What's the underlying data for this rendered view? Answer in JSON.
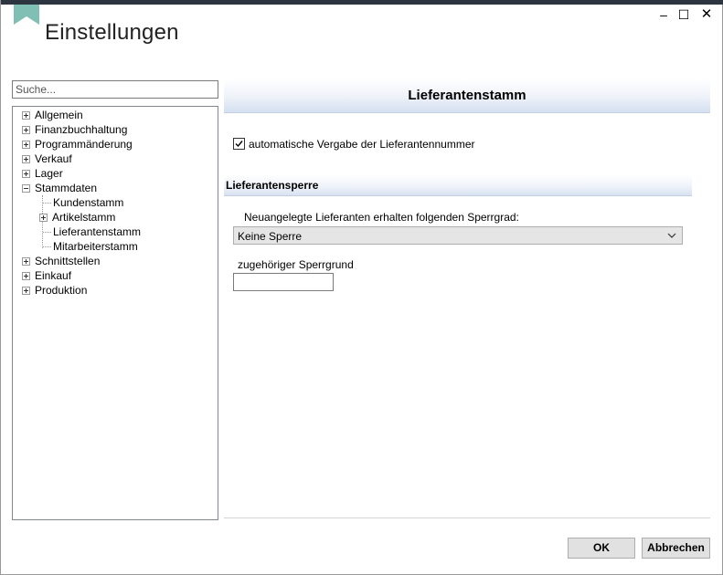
{
  "window": {
    "title": "Einstellungen",
    "controls": {
      "minimize": "–",
      "maximize": "☐",
      "close": "✕"
    },
    "accent_color": "#7fbfb4"
  },
  "search": {
    "placeholder": "Suche...",
    "value": ""
  },
  "tree": {
    "items": [
      {
        "label": "Allgemein",
        "expander": "plus",
        "level": 0
      },
      {
        "label": "Finanzbuchhaltung",
        "expander": "plus",
        "level": 0
      },
      {
        "label": "Programmänderung",
        "expander": "plus",
        "level": 0
      },
      {
        "label": "Verkauf",
        "expander": "plus",
        "level": 0
      },
      {
        "label": "Lager",
        "expander": "plus",
        "level": 0
      },
      {
        "label": "Stammdaten",
        "expander": "minus",
        "level": 0
      },
      {
        "label": "Kundenstamm",
        "expander": "none",
        "level": 1
      },
      {
        "label": "Artikelstamm",
        "expander": "plus",
        "level": 1
      },
      {
        "label": "Lieferantenstamm",
        "expander": "none",
        "level": 1,
        "selected": true
      },
      {
        "label": "Mitarbeiterstamm",
        "expander": "none",
        "level": 1
      },
      {
        "label": "Schnittstellen",
        "expander": "plus",
        "level": 0
      },
      {
        "label": "Einkauf",
        "expander": "plus",
        "level": 0
      },
      {
        "label": "Produktion",
        "expander": "plus",
        "level": 0
      }
    ]
  },
  "panel": {
    "header": "Lieferantenstamm",
    "auto_number": {
      "label": "automatische Vergabe der Lieferantennummer",
      "checked": true
    },
    "section": {
      "title": "Lieferantensperre",
      "sperrgrad_label": "Neuangelegte Lieferanten erhalten folgenden Sperrgrad:",
      "sperrgrad_value": "Keine Sperre",
      "sperrgrund_label": "zugehöriger Sperrgrund",
      "sperrgrund_value": ""
    }
  },
  "buttons": {
    "ok_label": "OK",
    "cancel_label": "Abbrechen"
  }
}
